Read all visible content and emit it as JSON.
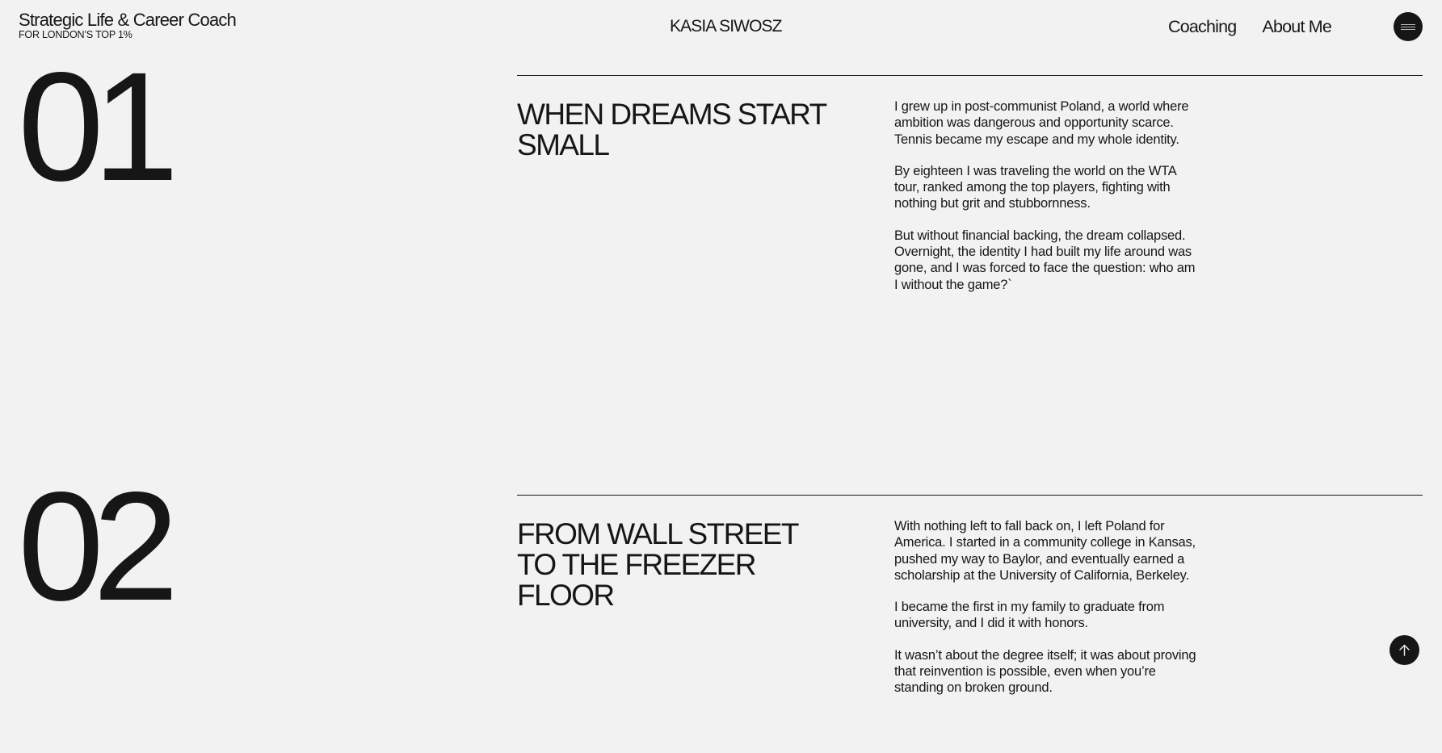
{
  "header": {
    "brand_title": "Strategic Life & Career Coach",
    "brand_subtitle": "FOR LONDON’S TOP 1%",
    "site_name": "KASIA SIWOSZ",
    "nav": [
      {
        "label": "Coaching"
      },
      {
        "label": "About Me"
      }
    ],
    "menu_icon": "hamburger-icon"
  },
  "sections": [
    {
      "number": "01",
      "title_lines": [
        "WHEN DREAMS START",
        "SMALL"
      ],
      "paragraphs": [
        "I grew up in post-communist Poland, a world where ambition was dangerous and opportunity scarce. Tennis became my escape and my whole identity.",
        "By eighteen I was traveling the world on the WTA tour, ranked among the top players, fighting with nothing but grit and stubbornness.",
        "But without financial backing, the dream collapsed.",
        "Overnight, the identity I had built my life around was gone, and I was forced to face the question: who am I without the game?`"
      ]
    },
    {
      "number": "02",
      "title_lines": [
        "FROM WALL STREET",
        "TO THE FREEZER",
        "FLOOR"
      ],
      "paragraphs": [
        "With nothing left to fall back on, I left Poland for America. I started in a community college in Kansas, pushed my way to Baylor, and eventually earned a scholarship at the University of California, Berkeley.",
        "I became the first in my family to graduate from university, and I did it with honors.",
        "It wasn’t about the degree itself; it was about proving that reinvention is possible, even when you’re standing on broken ground."
      ]
    }
  ],
  "back_to_top_icon": "arrow-up-icon",
  "colors": {
    "background": "#f2f2f2",
    "text": "#161616",
    "accent": "#161616"
  }
}
